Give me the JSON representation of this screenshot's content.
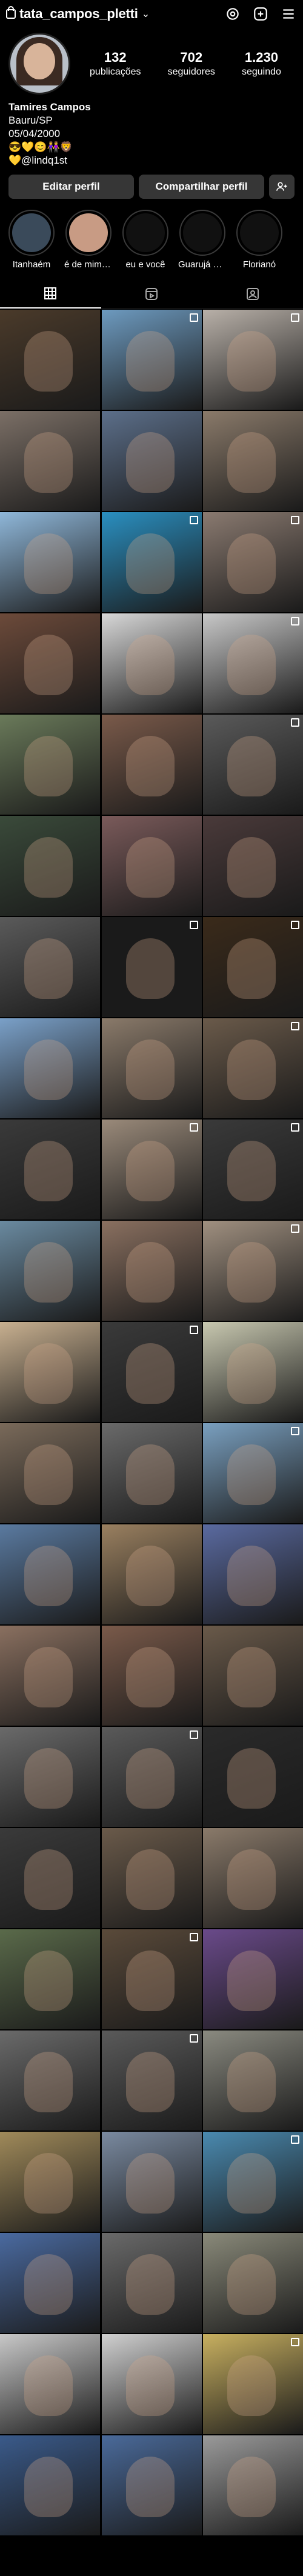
{
  "header": {
    "username": "tata_campos_pletti"
  },
  "profile": {
    "stats": [
      {
        "value": "132",
        "label": "publicações"
      },
      {
        "value": "702",
        "label": "seguidores"
      },
      {
        "value": "1.230",
        "label": "seguindo"
      }
    ],
    "name": "Tamires Campos",
    "bio_lines": [
      "Bauru/SP",
      "05/04/2000",
      "😎💛😊👭🦁",
      "💛@lindq1st"
    ]
  },
  "buttons": {
    "edit": "Editar perfil",
    "share": "Compartilhar perfil"
  },
  "highlights": [
    {
      "label": "Itanhaém",
      "color": "#3a4a5a"
    },
    {
      "label": "é de mim m...",
      "color": "#c89b84"
    },
    {
      "label": "eu e você",
      "color": "#111"
    },
    {
      "label": "Guarujá 16/...",
      "color": "#111"
    },
    {
      "label": "Florianó",
      "color": "#111"
    }
  ],
  "grid_colors": [
    [
      "#4a3a2a",
      "#6d9abf",
      "#b8b0a8"
    ],
    [
      "#7b6f66",
      "#5c6f8a",
      "#8a7a6a"
    ],
    [
      "#8fb7d9",
      "#2a8fc0",
      "#8a7a70"
    ],
    [
      "#6c4a3a",
      "#d8d8d8",
      "#c8c8c8"
    ],
    [
      "#6a7a5a",
      "#7a5a4a",
      "#5a5a5a"
    ],
    [
      "#3a4a3a",
      "#7a5a5a",
      "#4a3a3a"
    ],
    [
      "#5a5a5a",
      "#1a1a1a",
      "#3a2a1a"
    ],
    [
      "#7aa0c8",
      "#8a7a6a",
      "#6a5a4a"
    ],
    [
      "#3a3a3a",
      "#9a8a7a",
      "#3a3a3a"
    ],
    [
      "#6a8aa0",
      "#8a7060",
      "#a09080"
    ],
    [
      "#c8b090",
      "#3a3a3a",
      "#c8c8b0"
    ],
    [
      "#7a6a5a",
      "#6a6a6a",
      "#7aa0c0"
    ],
    [
      "#5a7aa0",
      "#9a8060",
      "#5a6aa0"
    ],
    [
      "#8a7060",
      "#7a5a4a",
      "#6a5a4a"
    ],
    [
      "#6a6a6a",
      "#5a5a5a",
      "#2a2a2a"
    ],
    [
      "#3a3a3a",
      "#6a5a4a",
      "#8a7a6a"
    ],
    [
      "#5a6a4a",
      "#5a4a3a",
      "#6a4a8a"
    ],
    [
      "#6a6a6a",
      "#5a5a5a",
      "#8a8a80"
    ],
    [
      "#a08a5a",
      "#7a8aa0",
      "#4a8ab0"
    ],
    [
      "#4a6aa0",
      "#6a6a6a",
      "#8a8a7a"
    ],
    [
      "#c8c8c8",
      "#d0d0d0",
      "#c8b060"
    ],
    [
      "#3a5a8a",
      "#4a6a9a",
      "#9a9a9a"
    ]
  ],
  "multi_marks": [
    [
      0,
      1
    ],
    [
      0,
      2
    ],
    [
      2,
      1
    ],
    [
      2,
      2
    ],
    [
      3,
      2
    ],
    [
      4,
      2
    ],
    [
      6,
      1
    ],
    [
      6,
      2
    ],
    [
      7,
      2
    ],
    [
      8,
      1
    ],
    [
      8,
      2
    ],
    [
      9,
      2
    ],
    [
      10,
      1
    ],
    [
      11,
      2
    ],
    [
      14,
      1
    ],
    [
      16,
      1
    ],
    [
      17,
      1
    ],
    [
      18,
      2
    ],
    [
      20,
      2
    ]
  ]
}
